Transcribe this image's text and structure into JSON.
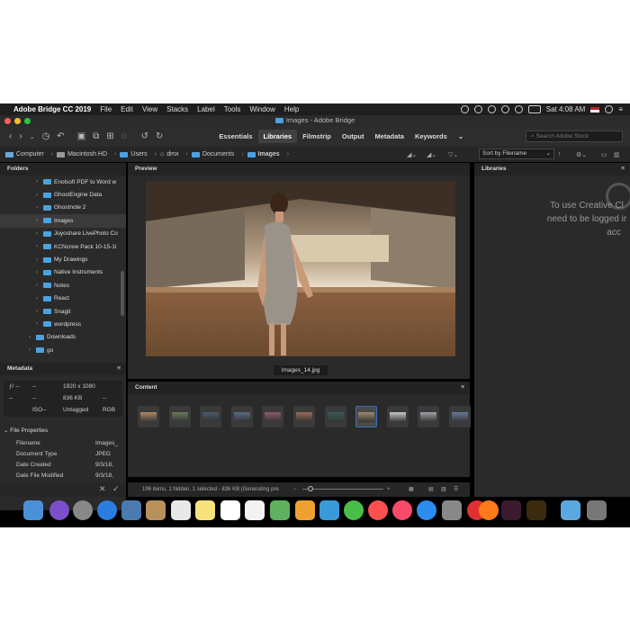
{
  "menubar": {
    "app": "Adobe Bridge CC 2019",
    "items": [
      "File",
      "Edit",
      "View",
      "Stacks",
      "Label",
      "Tools",
      "Window",
      "Help"
    ],
    "clock": "Sat 4:08 AM"
  },
  "window": {
    "title": "Images - Adobe Bridge"
  },
  "toolbar": {
    "workspaces": [
      "Essentials",
      "Libraries",
      "Filmstrip",
      "Output",
      "Metadata",
      "Keywords"
    ],
    "active_workspace": "Libraries",
    "search_placeholder": "Search Adobe Stock"
  },
  "pathbar": {
    "crumbs": [
      "Computer",
      "Macintosh HD",
      "Users",
      "dmx",
      "Documents",
      "Images"
    ],
    "sort": "Sort by Filename"
  },
  "folders": {
    "title": "Folders",
    "items": [
      {
        "label": "Enolsoft PDF to Word w",
        "level": 2
      },
      {
        "label": "GhostEngine Data",
        "level": 2
      },
      {
        "label": "Ghostnote 2",
        "level": 2
      },
      {
        "label": "Images",
        "level": 2,
        "selected": true
      },
      {
        "label": "Joyoshare LivePhoto Co",
        "level": 2
      },
      {
        "label": "KCNcrew Pack 10-15-1l",
        "level": 2
      },
      {
        "label": "My Drawings",
        "level": 2
      },
      {
        "label": "Native Instruments",
        "level": 2
      },
      {
        "label": "Notes",
        "level": 2
      },
      {
        "label": "React",
        "level": 2
      },
      {
        "label": "Snagit",
        "level": 2
      },
      {
        "label": "wordpress",
        "level": 2
      },
      {
        "label": "Downloads",
        "level": 1
      },
      {
        "label": "go",
        "level": 1
      }
    ]
  },
  "preview": {
    "title": "Preview",
    "filename": "Images_14.jpg"
  },
  "content": {
    "title": "Content",
    "status": "196 items, 1 hidden, 1 selected - 836 KB (Generating pre"
  },
  "metadata": {
    "title": "Metadata",
    "fstop": "ƒ/ --",
    "dash1": "--",
    "dash2": "--",
    "dash3": "--",
    "iso": "ISO--",
    "dims": "1920 x 1080",
    "size": "836 KB",
    "tagged": "Untagged",
    "dash4": "--",
    "rgb": "RGB",
    "section": "File Properties",
    "props": [
      {
        "k": "Filename",
        "v": "Images_"
      },
      {
        "k": "Document Type",
        "v": "JPEG"
      },
      {
        "k": "Date Created",
        "v": "9/3/18,"
      },
      {
        "k": "Date File Modified",
        "v": "9/3/18,"
      }
    ]
  },
  "libraries": {
    "title": "Libraries",
    "msg1": "To use Creative Cl",
    "msg2": "need to be logged ir",
    "msg3": "acc"
  },
  "colors": {
    "accent": "#3b6dbf",
    "folder": "#4aa3df"
  }
}
